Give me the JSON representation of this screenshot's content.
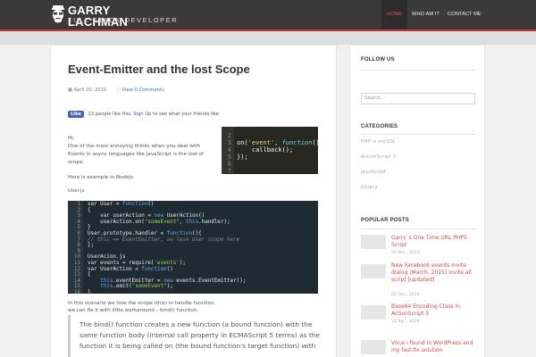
{
  "header": {
    "logo_name": "GARRY LACHMAN",
    "logo_sub": "FULL STACK DEVELOPER",
    "nav": [
      {
        "label": "HOME",
        "active": true
      },
      {
        "label": "WHO AM I?",
        "active": false
      },
      {
        "label": "CONTACT ME",
        "active": false
      }
    ],
    "accent": "#cc3333"
  },
  "post": {
    "title": "Event-Emitter and the lost Scope",
    "date": "April 20, 2015",
    "comments": "View 0 Comments",
    "fb_like_label": "Like",
    "fb_text_before": "13 people like this.",
    "fb_signup": "Sign Up",
    "fb_text_after": "to see what your friends like.",
    "greeting": "Hi,",
    "intro_lines": [
      "One of the most annoying thinks when you deal with",
      "Events in async languages like JavaScript is the lost of",
      "scope."
    ],
    "here_text": "Here is example in NodeJs",
    "file_label": "User.js",
    "thumb_code": {
      "line_numbers": "2\n3\n4\n5\n6\n7",
      "lines": [
        "on('event', function() {",
        "    callback();",
        "});"
      ]
    },
    "code": {
      "line_numbers": "1\n2\n3\n4\n5\n6\n7\n8\n9\n10\n11\n12\n13\n14\n15\n16\n17",
      "lines": [
        "var User = function()",
        "{",
        "    var userAction = new UserAction()",
        "    userAction.on(\"someEvent\", this.handler);",
        "}",
        "User.prototype.handler = function(){",
        "// this == EventEmitter, we lose User scope here",
        "};",
        "",
        "UserAcion.js",
        "var events = require('events');",
        "var UserAction = function()",
        "{",
        "    this.eventEmitter = new events.EventEmitter();",
        "    this.emit(\"someEvent\");",
        "}",
        ""
      ]
    },
    "after_lines": [
      "In this scenario we lose the scope (this) in handle function,",
      "we can fix it with little workaround – bind() function."
    ],
    "quote_lines": [
      "The bind() function creates a new function (a bound function) with the",
      "same function body (internal call property in ECMAScript 5 terms) as the",
      "function it is being called on (the bound function's target function) with"
    ]
  },
  "sidebar": {
    "follow_title": "FOLLOW US",
    "search_placeholder": "Search...",
    "categories_title": "CATEGORIES",
    "categories": [
      "PHP + mySQL",
      "ActionScript 3",
      "JavaScript",
      "jQuery"
    ],
    "popular_title": "POPULAR POSTS",
    "posts": [
      {
        "title_lines": [
          "Garry`s One Time URL PHP5",
          "Script"
        ],
        "date": "05 Mar , 2015"
      },
      {
        "title_lines": [
          "New Facebook events invite",
          "dialog (March, 2015) invite all",
          "script [updated]"
        ],
        "date": "02 Oct , 2014"
      },
      {
        "title_lines": [
          "Base64 Encoding Class in",
          "ActionScript 3"
        ],
        "date": "21 Apr , 2019"
      },
      {
        "title_lines": [
          "Virus i found in WordPress and",
          "my fast fix solution"
        ],
        "date": ""
      }
    ]
  }
}
